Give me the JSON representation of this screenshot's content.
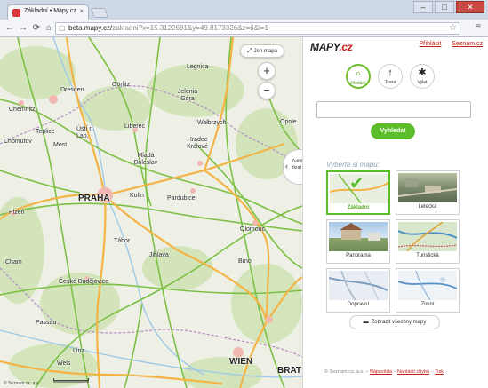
{
  "browser": {
    "tab_title": "Základní • Mapy.cz",
    "tab_close": "×",
    "url_host": "beta.mapy.cz/",
    "url_path": "zakladni?x=15.3122681&y=49.8173326&z=6&l=1",
    "window_controls": {
      "minimize": "–",
      "maximize": "□",
      "close": "✕"
    }
  },
  "map": {
    "full_map_button": "Jen mapa",
    "zoom_in": "+",
    "zoom_out": "−",
    "collapse_tab_text": "Zvětšit zkrat",
    "footer": "© Seznam.cz, a.s.",
    "cities": [
      {
        "name": "Dresden"
      },
      {
        "name": "Görlitz"
      },
      {
        "name": "Legnica"
      },
      {
        "name": "Jelenia Góra"
      },
      {
        "name": "Chemnitz"
      },
      {
        "name": "Teplice"
      },
      {
        "name": "Ústí n. Lab."
      },
      {
        "name": "Liberec"
      },
      {
        "name": "Wałbrzych"
      },
      {
        "name": "Chomutov"
      },
      {
        "name": "Most"
      },
      {
        "name": "Mladá Boleslav"
      },
      {
        "name": "Hradec Králové"
      },
      {
        "name": "PRAHA"
      },
      {
        "name": "Kolín"
      },
      {
        "name": "Pardubice"
      },
      {
        "name": "Plzeň"
      },
      {
        "name": "Tábor"
      },
      {
        "name": "Jihlava"
      },
      {
        "name": "Olomouc"
      },
      {
        "name": "České Budějovice"
      },
      {
        "name": "Brno"
      },
      {
        "name": "Passau"
      },
      {
        "name": "Linz"
      },
      {
        "name": "Wels"
      },
      {
        "name": "WIEN"
      },
      {
        "name": "BRAT"
      },
      {
        "name": "Opole"
      },
      {
        "name": "Cham"
      }
    ]
  },
  "panel": {
    "logo_prefix": "MAPY",
    "logo_suffix": ".cz",
    "login": "Přihlásit",
    "seznam": "Seznam.cz",
    "modes": [
      {
        "label": "Hledání",
        "icon": "search-icon"
      },
      {
        "label": "Trasa",
        "icon": "route-arrow-icon"
      },
      {
        "label": "Výlet",
        "icon": "trip-star-icon"
      }
    ],
    "search_value": "",
    "search_button": "Vyhledat",
    "choose_title": "Vyberte si mapu:",
    "map_types": [
      {
        "label": "Základní",
        "selected": true
      },
      {
        "label": "Letecká",
        "selected": false
      },
      {
        "label": "Panorama",
        "selected": false
      },
      {
        "label": "Turistická",
        "selected": false
      },
      {
        "label": "Dopravní",
        "selected": false
      },
      {
        "label": "Zimní",
        "selected": false
      }
    ],
    "show_all": "Zobrazit všechny mapy",
    "footer": {
      "copyright": "© Seznam.cz, a.s.",
      "help": "Nápověda",
      "report": "Nahlásit chybu",
      "print": "Tisk"
    }
  },
  "colors": {
    "accent_green": "#5bbd2a",
    "brand_red": "#c6211a",
    "road_orange": "#f3b447",
    "road_green": "#7bc043"
  }
}
